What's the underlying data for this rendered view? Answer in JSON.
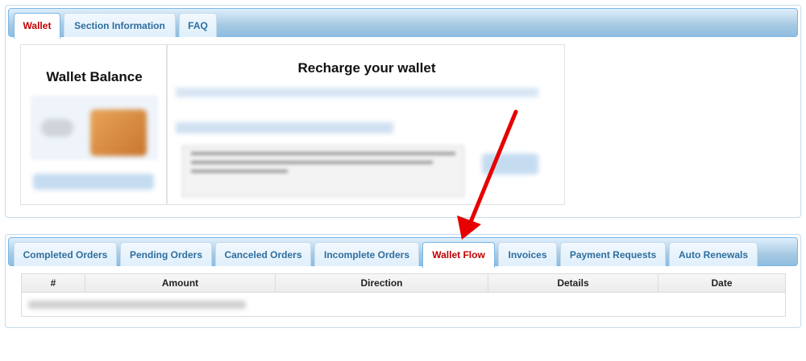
{
  "top_tabs": [
    {
      "label": "Wallet",
      "active": true
    },
    {
      "label": "Section Information",
      "active": false
    },
    {
      "label": "FAQ",
      "active": false
    }
  ],
  "wallet_balance": {
    "title": "Wallet Balance"
  },
  "recharge": {
    "title": "Recharge your wallet"
  },
  "bottom_tabs": [
    {
      "label": "Completed Orders",
      "active": false
    },
    {
      "label": "Pending Orders",
      "active": false
    },
    {
      "label": "Canceled Orders",
      "active": false
    },
    {
      "label": "Incomplete Orders",
      "active": false
    },
    {
      "label": "Wallet Flow",
      "active": true
    },
    {
      "label": "Invoices",
      "active": false
    },
    {
      "label": "Payment Requests",
      "active": false
    },
    {
      "label": "Auto Renewals",
      "active": false
    }
  ],
  "table": {
    "columns": [
      "#",
      "Amount",
      "Direction",
      "Details",
      "Date"
    ]
  },
  "colors": {
    "active_tab_text": "#c10000",
    "tab_text": "#2e6e9e",
    "arrow": "#e60000"
  }
}
